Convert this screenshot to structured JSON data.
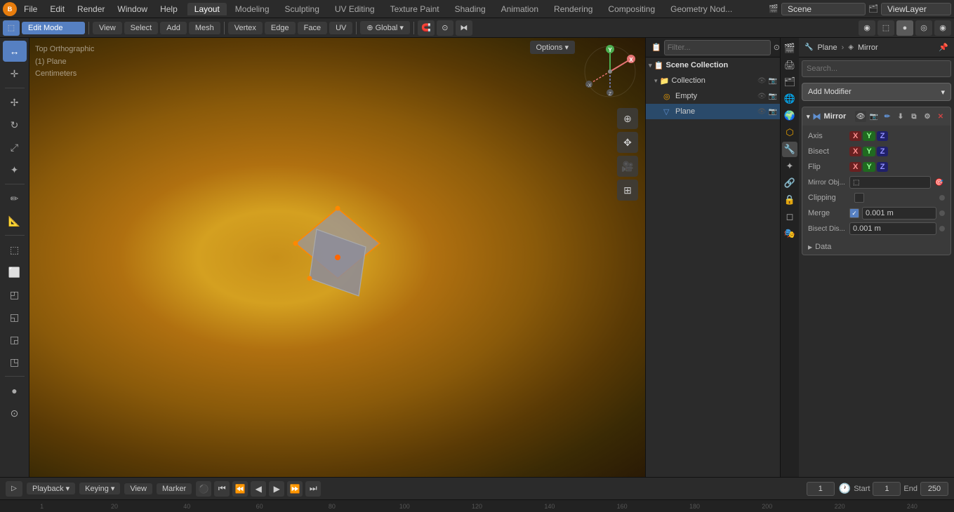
{
  "app": {
    "title": "Blender"
  },
  "top_menu": {
    "items": [
      "File",
      "Edit",
      "Render",
      "Window",
      "Help"
    ]
  },
  "workspace_tabs": {
    "tabs": [
      "Layout",
      "Modeling",
      "Sculpting",
      "UV Editing",
      "Texture Paint",
      "Shading",
      "Animation",
      "Rendering",
      "Compositing",
      "Geometry Nod..."
    ],
    "active": "Layout"
  },
  "scene": {
    "name": "Scene",
    "view_layer": "ViewLayer"
  },
  "second_toolbar": {
    "mode": "Edit Mode",
    "view": "View",
    "select": "Select",
    "add": "Add",
    "mesh": "Mesh",
    "vertex": "Vertex",
    "edge": "Edge",
    "face": "Face",
    "uv": "UV",
    "transform": "Global",
    "proportional": "OFF"
  },
  "viewport": {
    "info_line1": "Top Orthographic",
    "info_line2": "(1) Plane",
    "info_line3": "Centimeters"
  },
  "gizmo": {
    "y": "Y",
    "x": "-X",
    "xr": "X",
    "z": "Z"
  },
  "viewport_tools": [
    {
      "icon": "⊕",
      "name": "zoom-icon"
    },
    {
      "icon": "✥",
      "name": "pan-icon"
    },
    {
      "icon": "🎥",
      "name": "camera-icon"
    },
    {
      "icon": "⊞",
      "name": "grid-icon"
    }
  ],
  "left_tools": [
    {
      "icon": "↔",
      "name": "select-box-tool",
      "active": true
    },
    {
      "icon": "↻",
      "name": "rotate-tool"
    },
    {
      "icon": "⤢",
      "name": "scale-tool"
    },
    {
      "icon": "✢",
      "name": "transform-tool"
    },
    {
      "sep": true
    },
    {
      "icon": "✏",
      "name": "annotate-tool"
    },
    {
      "icon": "📐",
      "name": "measure-tool"
    },
    {
      "sep": true
    },
    {
      "icon": "⬚",
      "name": "add-cube-tool"
    },
    {
      "icon": "⬜",
      "name": "inset-tool"
    },
    {
      "icon": "◰",
      "name": "extrude-tool"
    },
    {
      "icon": "◱",
      "name": "bevel-tool"
    },
    {
      "icon": "◲",
      "name": "loop-cut-tool"
    },
    {
      "icon": "◳",
      "name": "offset-tool"
    },
    {
      "sep": true
    },
    {
      "icon": "●",
      "name": "shading-smooth-tool"
    },
    {
      "icon": "⊙",
      "name": "uv-tool"
    }
  ],
  "header_row": {
    "select_box_icon": "⬚",
    "overlays": "Options",
    "xyz_labels": [
      "X",
      "Y",
      "Z"
    ]
  },
  "outliner": {
    "title": "Scene Collection",
    "items": [
      {
        "level": 0,
        "label": "Scene Collection",
        "icon": "📁",
        "expanded": true
      },
      {
        "level": 1,
        "label": "Collection",
        "icon": "📁",
        "expanded": true
      },
      {
        "level": 2,
        "label": "Empty",
        "icon": "◎",
        "type": "empty"
      },
      {
        "level": 2,
        "label": "Plane",
        "icon": "◻",
        "type": "mesh",
        "active": true
      }
    ]
  },
  "properties": {
    "breadcrumb_obj": "Plane",
    "breadcrumb_arrow": "›",
    "breadcrumb_mod": "Mirror",
    "search_placeholder": "Search...",
    "add_modifier_label": "Add Modifier",
    "modifier": {
      "name": "Mirror",
      "icon": "⧓",
      "axis_label": "Axis",
      "bisect_label": "Bisect",
      "flip_label": "Flip",
      "mirror_obj_label": "Mirror Obj...",
      "clipping_label": "Clipping",
      "merge_label": "Merge",
      "merge_value": "0.001 m",
      "bisect_dis_label": "Bisect Dis...",
      "bisect_dis_value": "0.001 m",
      "data_label": "Data"
    }
  },
  "bottom_bar": {
    "playback_label": "Playback",
    "keying_label": "Keying",
    "view_label": "View",
    "marker_label": "Marker",
    "frame_current": "1",
    "frame_start_label": "Start",
    "frame_start": "1",
    "frame_end_label": "End",
    "frame_end": "250"
  },
  "timeline": {
    "marks": [
      "1",
      "20",
      "40",
      "60",
      "80",
      "100",
      "120",
      "140",
      "160",
      "180",
      "200",
      "220",
      "240"
    ]
  },
  "prop_tabs": [
    {
      "icon": "🎬",
      "name": "tab-render",
      "active": false
    },
    {
      "icon": "📷",
      "name": "tab-output",
      "active": false
    },
    {
      "icon": "🌍",
      "name": "tab-view-layer",
      "active": false
    },
    {
      "icon": "🎨",
      "name": "tab-scene",
      "active": false
    },
    {
      "icon": "🌐",
      "name": "tab-world",
      "active": false
    },
    {
      "icon": "🔧",
      "name": "tab-object",
      "active": false
    },
    {
      "icon": "⚙",
      "name": "tab-modifier",
      "active": true
    },
    {
      "icon": "⬡",
      "name": "tab-particles",
      "active": false
    },
    {
      "icon": "🔗",
      "name": "tab-physics",
      "active": false
    },
    {
      "icon": "📐",
      "name": "tab-constraints",
      "active": false
    },
    {
      "icon": "💎",
      "name": "tab-data",
      "active": false
    },
    {
      "icon": "🎭",
      "name": "tab-material",
      "active": false
    }
  ]
}
